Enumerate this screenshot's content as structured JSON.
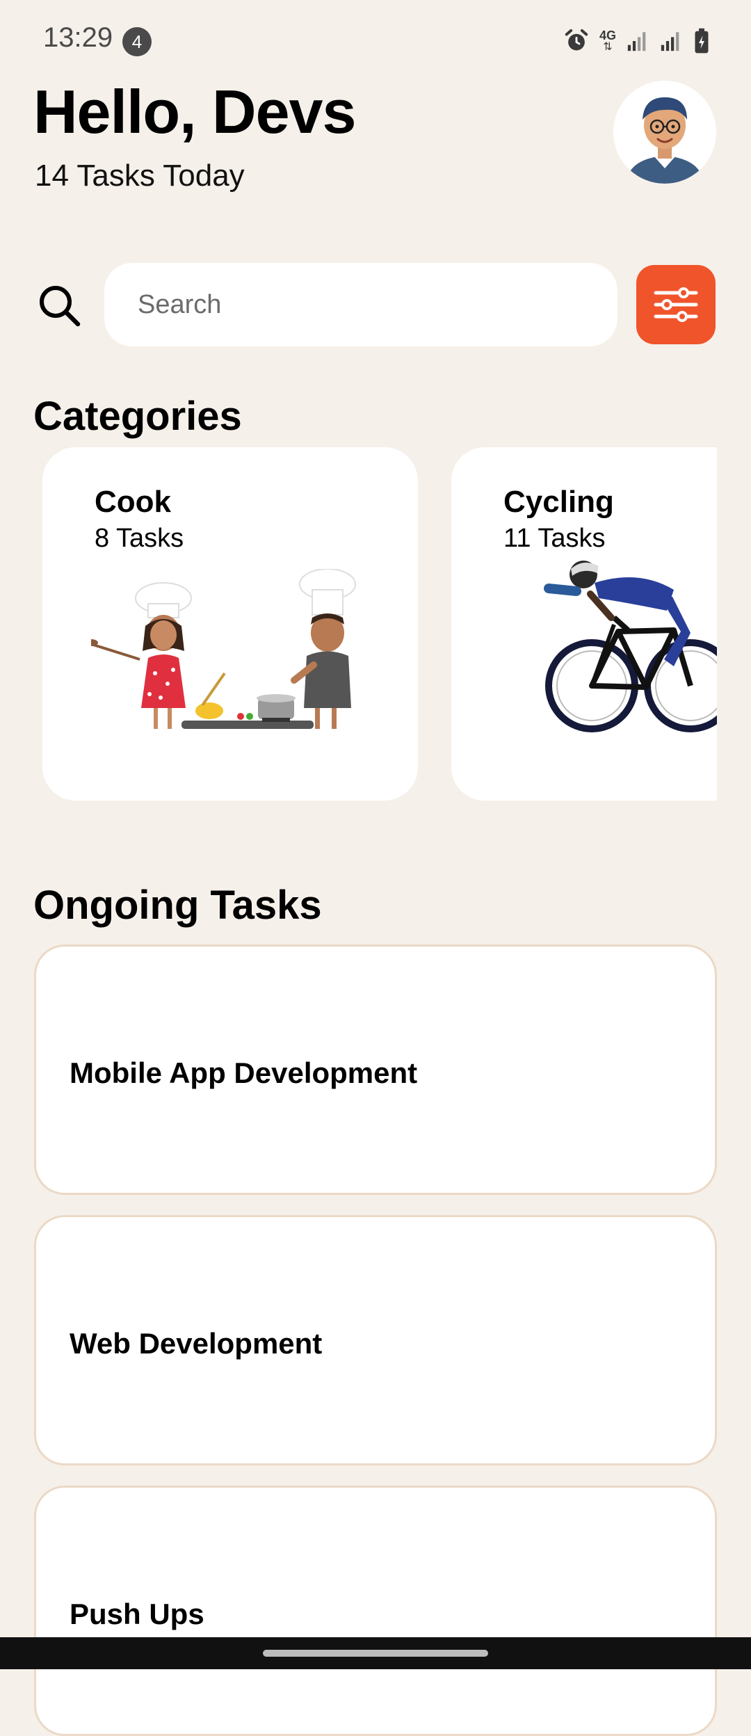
{
  "status_bar": {
    "time": "13:29",
    "notification_count": "4",
    "network": "4G"
  },
  "header": {
    "greeting": "Hello, Devs",
    "subtitle": "14 Tasks Today"
  },
  "search": {
    "placeholder": "Search"
  },
  "categories": {
    "title": "Categories",
    "items": [
      {
        "name": "Cook",
        "count": "8 Tasks"
      },
      {
        "name": "Cycling",
        "count": "11 Tasks"
      }
    ]
  },
  "ongoing": {
    "title": "Ongoing Tasks",
    "items": [
      {
        "name": "Mobile App Development"
      },
      {
        "name": "Web Development"
      },
      {
        "name": "Push Ups"
      }
    ]
  },
  "colors": {
    "background": "#F6F0EA",
    "accent": "#F0542A",
    "card": "#FFFFFF",
    "card_border": "#EBD9C6"
  }
}
